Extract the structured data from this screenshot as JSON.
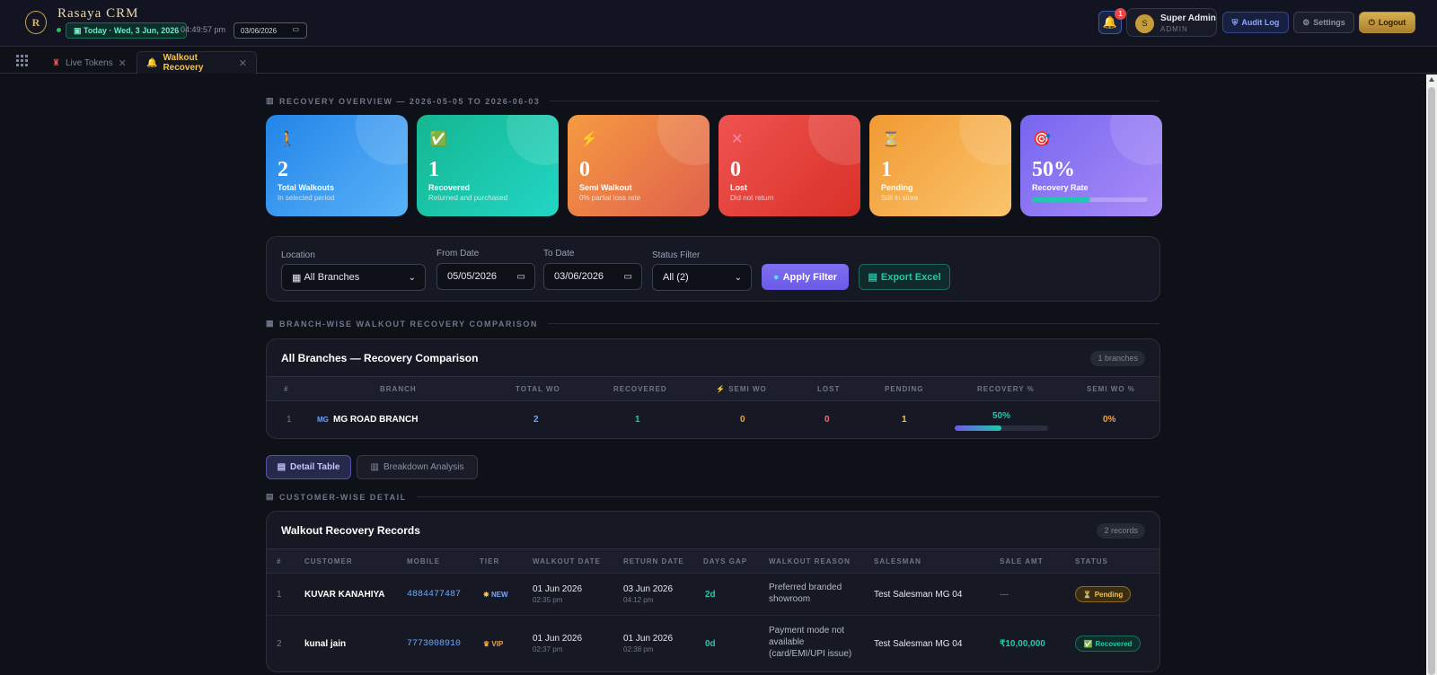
{
  "header": {
    "logo_glyph": "R",
    "brand": "Rasaya CRM",
    "today": "Today · Wed, 3 Jun, 2026",
    "time": "04:49:57 pm",
    "date_value": "03/06/2026",
    "notification_count": "1",
    "user_initial": "S",
    "user_name": "Super Admin",
    "user_role": "ADMIN",
    "audit_label": "Audit Log",
    "settings_label": "Settings",
    "logout_label": "Logout"
  },
  "tabs": [
    {
      "label": "Live Tokens",
      "close": "✕"
    },
    {
      "label": "Walkout Recovery",
      "close": "✕"
    }
  ],
  "overview": {
    "title": "RECOVERY OVERVIEW — 2026-05-05 TO 2026-06-03",
    "icon": "chart-icon"
  },
  "cards": [
    {
      "value": "2",
      "label": "Total Walkouts",
      "sub": "In selected period"
    },
    {
      "value": "1",
      "label": "Recovered",
      "sub": "Returned and purchased"
    },
    {
      "value": "0",
      "label": "Semi Walkout",
      "sub": "0% partial loss rate"
    },
    {
      "value": "0",
      "label": "Lost",
      "sub": "Did not return"
    },
    {
      "value": "1",
      "label": "Pending",
      "sub": "Still in store"
    },
    {
      "value": "50%",
      "label": "Recovery Rate",
      "sub": "",
      "progress": 0.5
    }
  ],
  "filter": {
    "location_label": "Location",
    "location_value": "All Branches",
    "from_label": "From Date",
    "from_value": "05/05/2026",
    "to_label": "To Date",
    "to_value": "03/06/2026",
    "status_label": "Status Filter",
    "status_value": "All (2)",
    "apply_label": "Apply Filter",
    "export_label": "Export Excel"
  },
  "branch_section": {
    "title": "BRANCH-WISE WALKOUT RECOVERY COMPARISON"
  },
  "branch_table": {
    "title": "All Branches — Recovery Comparison",
    "count": "1 branches",
    "headers": [
      "#",
      "BRANCH",
      "TOTAL WO",
      "RECOVERED",
      "SEMI WO",
      "LOST",
      "PENDING",
      "RECOVERY %",
      "SEMI WO %"
    ],
    "rows": [
      {
        "index": "1",
        "badge": "MG",
        "branch": "MG ROAD BRANCH",
        "total": "2",
        "recovered": "1",
        "semi": "0",
        "lost": "0",
        "pending": "1",
        "recovery": "50%",
        "recovery_fraction": 0.5,
        "semi_pct": "0%"
      }
    ]
  },
  "view_tabs": {
    "detail": "Detail Table",
    "breakdown": "Breakdown Analysis"
  },
  "detail_section": {
    "title": "CUSTOMER-WISE DETAIL"
  },
  "records": {
    "title": "Walkout Recovery Records",
    "count": "2 records",
    "headers": [
      "#",
      "CUSTOMER",
      "MOBILE",
      "TIER",
      "WALKOUT DATE",
      "RETURN DATE",
      "DAYS GAP",
      "WALKOUT REASON",
      "SALESMAN",
      "SALE AMT",
      "STATUS"
    ],
    "rows": [
      {
        "index": "1",
        "customer": "KUVAR KANAHIYA",
        "mobile": "4884477487",
        "tier": "NEW",
        "walkout_date": "01 Jun 2026",
        "walkout_time": "02:35 pm",
        "return_date": "03 Jun 2026",
        "return_time": "04:12 pm",
        "gap": "2d",
        "reason_1": "Preferred branded",
        "reason_2": "showroom",
        "reason_3": "",
        "salesman": "Test Salesman MG 04",
        "sale_amt": "—",
        "status": "Pending"
      },
      {
        "index": "2",
        "customer": "kunal jain",
        "mobile": "7773008910",
        "tier": "VIP",
        "walkout_date": "01 Jun 2026",
        "walkout_time": "02:37 pm",
        "return_date": "01 Jun 2026",
        "return_time": "02:38 pm",
        "gap": "0d",
        "reason_1": "Payment mode not",
        "reason_2": "available",
        "reason_3": "(card/EMI/UPI issue)",
        "salesman": "Test Salesman MG 04",
        "sale_amt": "₹10,00,000",
        "status": "Recovered"
      }
    ]
  },
  "colors": {
    "accent": "#f6c34a",
    "recovered": "#1fc9a9",
    "pending": "#f6c34a",
    "lost": "#f87171",
    "link": "#6aa7ff"
  }
}
